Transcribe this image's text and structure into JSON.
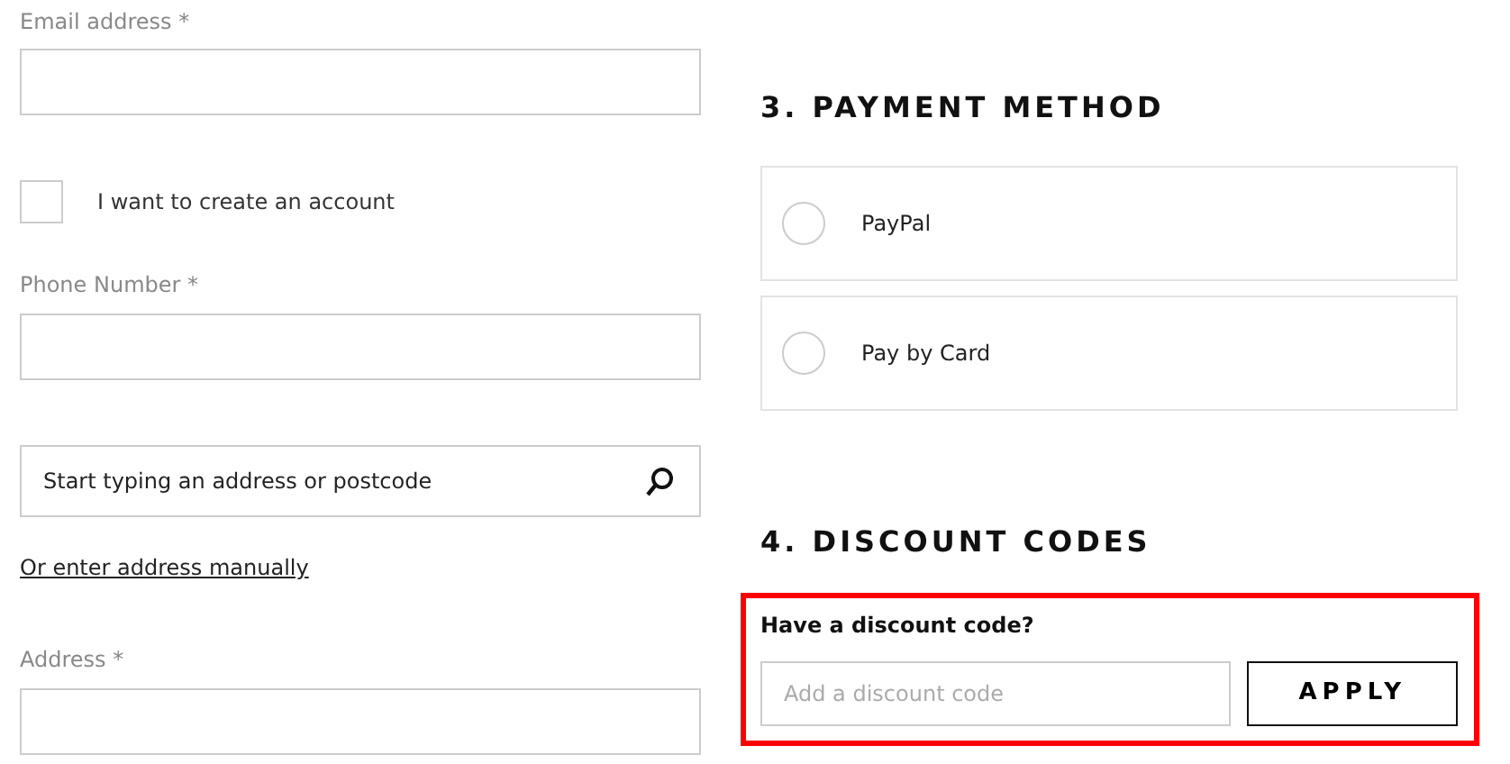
{
  "contact": {
    "email": {
      "label": "Email address *"
    },
    "create_account": {
      "label": "I want to create an account",
      "checked": false
    },
    "phone": {
      "label": "Phone Number *"
    },
    "address_search": {
      "placeholder": "Start typing an address or postcode"
    },
    "manual_link": "Or enter address manually",
    "address": {
      "label": "Address *"
    }
  },
  "payment": {
    "heading": "3. PAYMENT METHOD",
    "options": [
      {
        "label": "PayPal",
        "selected": false
      },
      {
        "label": "Pay by Card",
        "selected": false
      }
    ]
  },
  "discount": {
    "heading": "4. DISCOUNT CODES",
    "highlighted": true,
    "label": "Have a discount code?",
    "placeholder": "Add a discount code",
    "button": "APPLY"
  }
}
